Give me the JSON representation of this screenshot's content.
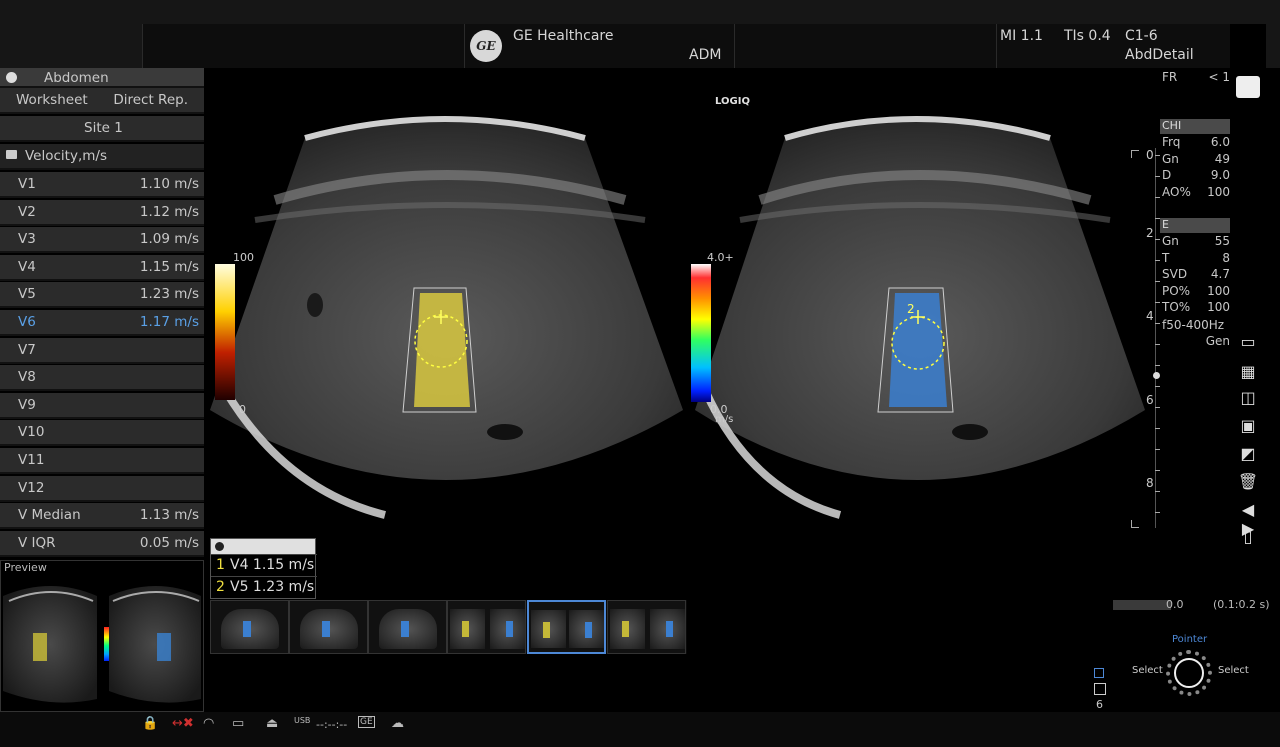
{
  "header": {
    "brand_logo": "GE",
    "brand_name": "GE Healthcare",
    "operator": "ADM",
    "mi": "MI 1.1",
    "tis": "TIs 0.4",
    "probe": "C1-6",
    "preset": "AbdDetail",
    "logo_text": "LOGIQ"
  },
  "left_panel": {
    "exam": "Abdomen",
    "worksheet": "Worksheet",
    "direct_rep": "Direct Rep.",
    "site": "Site 1",
    "group": "Velocity,m/s",
    "rows": [
      {
        "label": "V1",
        "value": "1.10 m/s"
      },
      {
        "label": "V2",
        "value": "1.12 m/s"
      },
      {
        "label": "V3",
        "value": "1.09 m/s"
      },
      {
        "label": "V4",
        "value": "1.15 m/s"
      },
      {
        "label": "V5",
        "value": "1.23 m/s"
      },
      {
        "label": "V6",
        "value": "1.17 m/s"
      },
      {
        "label": "V7",
        "value": ""
      },
      {
        "label": "V8",
        "value": ""
      },
      {
        "label": "V9",
        "value": ""
      },
      {
        "label": "V10",
        "value": ""
      },
      {
        "label": "V11",
        "value": ""
      },
      {
        "label": "V12",
        "value": ""
      },
      {
        "label": "V Median",
        "value": "1.13 m/s"
      },
      {
        "label": "V IQR",
        "value": "0.05 m/s"
      }
    ],
    "preview_label": "Preview"
  },
  "left_scale": {
    "top": "100",
    "bottom": "0"
  },
  "right_scale": {
    "top": "4.0+",
    "bottom": "0.0",
    "unit": "m/s"
  },
  "roi_marker": "2",
  "measurements": [
    {
      "n": "1",
      "text": "V4  1.15 m/s"
    },
    {
      "n": "2",
      "text": "V5  1.23 m/s"
    }
  ],
  "params": {
    "fr_label": "FR",
    "fr_value": "< 1",
    "chi_head": "CHI",
    "chi": [
      {
        "k": "Frq",
        "v": "6.0"
      },
      {
        "k": "Gn",
        "v": "49"
      },
      {
        "k": "D",
        "v": "9.0"
      },
      {
        "k": "AO%",
        "v": "100"
      }
    ],
    "e_head": "E",
    "e": [
      {
        "k": "Gn",
        "v": "55"
      },
      {
        "k": "T",
        "v": "8"
      },
      {
        "k": "SVD",
        "v": "4.7"
      },
      {
        "k": "PO%",
        "v": "100"
      },
      {
        "k": "TO%",
        "v": "100"
      }
    ],
    "freq": "f50-400Hz",
    "gen": "Gen"
  },
  "depth": [
    "0",
    "2",
    "4",
    "6",
    "8"
  ],
  "cine": {
    "start": "0.0",
    "range": "(0.1:0.2 s)"
  },
  "trackball": {
    "title": "Pointer",
    "left": "Select",
    "right": "Select"
  },
  "page_count": "6",
  "status": {
    "usb": "USB",
    "time": "--:--:--",
    "ge": "GE"
  },
  "colors": {
    "accent": "#4d88d6",
    "highlight_text": "#5aa0e6",
    "roi_yellow": "#d8c840",
    "roi_blue": "#3b7fd0"
  }
}
